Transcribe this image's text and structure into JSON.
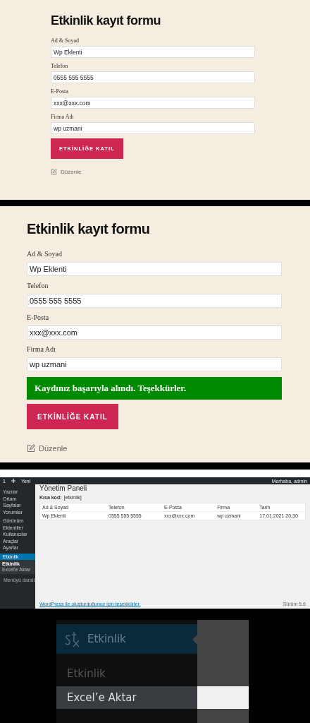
{
  "form_screens": [
    {
      "title": "Etkinlik kayıt formu",
      "fields": [
        {
          "label": "Ad & Soyad",
          "value": "Wp Eklenti"
        },
        {
          "label": "Telefon",
          "value": "0555 555 5555"
        },
        {
          "label": "E-Posta",
          "value": "xxx@xxx.com"
        },
        {
          "label": "Firma Adı",
          "value": "wp uzmani"
        }
      ],
      "button": "ETKİNLİĞE KATIL",
      "edit_link": "Düzenle"
    },
    {
      "title": "Etkinlik kayıt formu",
      "fields": [
        {
          "label": "Ad & Soyad",
          "value": "Wp Eklenti"
        },
        {
          "label": "Telefon",
          "value": "0555 555 5555"
        },
        {
          "label": "E-Posta",
          "value": "xxx@xxx.com"
        },
        {
          "label": "Firma Adı",
          "value": "wp uzmani"
        }
      ],
      "message": {
        "kind": "success",
        "text": "Kaydınız başarıyla alındı. Teşekkürler."
      },
      "button": "ETKİNLİĞE KATIL",
      "edit_link": "Düzenle"
    }
  ],
  "admin_panel": {
    "admin_bar": {
      "comments": "1",
      "new": "Yeni",
      "greeting": "Merhaba, admin"
    },
    "sidebar": {
      "items": [
        {
          "label": "Yazılar",
          "selected": false
        },
        {
          "label": "Ortam",
          "selected": false
        },
        {
          "label": "Sayfalar",
          "selected": false
        },
        {
          "label": "Yorumlar",
          "selected": false
        },
        {
          "label": "Görünüm",
          "selected": false
        },
        {
          "label": "Eklentiler",
          "selected": false
        },
        {
          "label": "Kullanıcılar",
          "selected": false
        },
        {
          "label": "Araçlar",
          "selected": false
        },
        {
          "label": "Ayarlar",
          "selected": false
        },
        {
          "label": "Etkinlik",
          "selected": true,
          "children": [
            {
              "label": "Etkinlik",
              "selected": true
            },
            {
              "label": "Excel'e Aktar",
              "selected": false
            }
          ]
        }
      ],
      "collapse": "Menüyü daralt"
    },
    "title": "Yönetim Paneli",
    "shortcode_label": "Kısa kod:",
    "shortcode": "[etkinlik]",
    "table": {
      "columns": [
        "Ad & Soyad",
        "Telefon",
        "E-Posta",
        "Firma",
        "Tarih"
      ],
      "rows": [
        [
          "Wp Eklenti",
          "0555 555 5555",
          "xxx@xxx.com",
          "wp uzmani",
          "17.01.2021 20:30"
        ]
      ]
    },
    "footer": "WordPress ile oluşturduğunuz için teşekkürler.",
    "version": "Sürüm 5.6"
  },
  "menu_closeup": {
    "header": "Etkinlik",
    "items": [
      {
        "label": "Etkinlik",
        "selected": false
      },
      {
        "label": "Excel’e Aktar",
        "selected": true
      }
    ]
  }
}
